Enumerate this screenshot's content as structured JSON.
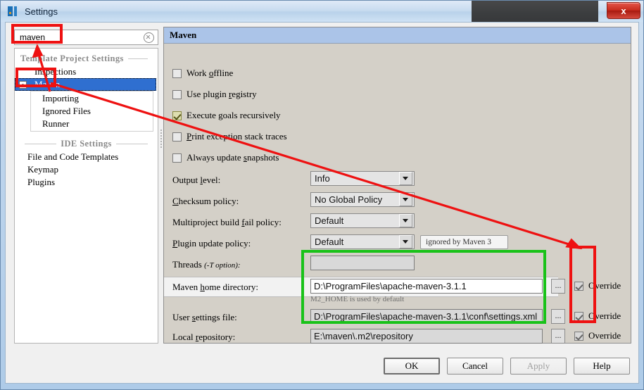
{
  "window": {
    "title": "Settings",
    "icon": "intellij-idea-icon",
    "close_label": "x"
  },
  "search": {
    "value": "maven",
    "placeholder": "",
    "clear_icon": "clear-circle-icon"
  },
  "tree": {
    "group_project": "Template Project Settings",
    "group_ide": "IDE Settings",
    "items": [
      {
        "label": "Inspections",
        "level": 1,
        "selected": false
      },
      {
        "label": "Maven",
        "level": 1,
        "selected": true,
        "expander": "-"
      },
      {
        "label": "Importing",
        "level": 2,
        "selected": false
      },
      {
        "label": "Ignored Files",
        "level": 2,
        "selected": false
      },
      {
        "label": "Runner",
        "level": 2,
        "selected": false
      }
    ],
    "ide_items": [
      {
        "label": "File and Code Templates"
      },
      {
        "label": "Keymap"
      },
      {
        "label": "Plugins"
      }
    ]
  },
  "pane": {
    "title": "Maven",
    "checkboxes": [
      {
        "label": "Work offline",
        "mnemonic": "o",
        "pre": "Work ",
        "post": "ffline",
        "checked": false
      },
      {
        "label": "Use plugin registry",
        "mnemonic": "r",
        "pre": "Use plugin ",
        "post": "egistry",
        "checked": false
      },
      {
        "label": "Execute goals recursively",
        "mnemonic": "",
        "pre": "Execute goals recursively",
        "post": "",
        "checked": true
      },
      {
        "label": "Print exception stack traces",
        "mnemonic": "P",
        "pre": "",
        "post": "rint exception stack traces",
        "checked": false
      },
      {
        "label": "Always update snapshots",
        "mnemonic": "s",
        "pre": "Always update ",
        "post": "napshots",
        "checked": false
      }
    ],
    "combos": [
      {
        "label_pre": "Output ",
        "label_mn": "l",
        "label_post": "evel:",
        "value": "Info"
      },
      {
        "label_pre": "",
        "label_mn": "C",
        "label_post": "hecksum policy:",
        "value": "No Global Policy"
      },
      {
        "label_pre": "Multiproject build ",
        "label_mn": "f",
        "label_post": "ail policy:",
        "value": "Default"
      },
      {
        "label_pre": "",
        "label_mn": "P",
        "label_post": "lugin update policy:",
        "value": "Default"
      }
    ],
    "plugin_policy_note": "ignored by Maven 3",
    "threads_label_main": "Threads",
    "threads_label_hint": "(-T option):",
    "threads_value": "",
    "paths": [
      {
        "label_pre": "Maven ",
        "label_mn": "h",
        "label_post": "ome directory:",
        "value": "D:\\ProgramFiles\\apache-maven-3.1.1",
        "browse": "...",
        "override": "Override",
        "override_checked": true,
        "hint": "M2_HOME is used by default"
      },
      {
        "label_pre": "User ",
        "label_mn": "s",
        "label_post": "ettings file:",
        "value": "D:\\ProgramFiles\\apache-maven-3.1.1\\conf\\settings.xml",
        "browse": "...",
        "override": "Override",
        "override_checked": true,
        "hint": ""
      },
      {
        "label_pre": "Local ",
        "label_mn": "r",
        "label_post": "epository:",
        "value": "E:\\maven\\.m2\\repository",
        "browse": "...",
        "override": "Override",
        "override_checked": true,
        "hint": ""
      }
    ]
  },
  "buttons": {
    "ok": "OK",
    "cancel": "Cancel",
    "apply": "Apply",
    "help": "Help"
  },
  "annotation": {
    "color_red": "#ee1111",
    "color_green": "#19c219"
  }
}
